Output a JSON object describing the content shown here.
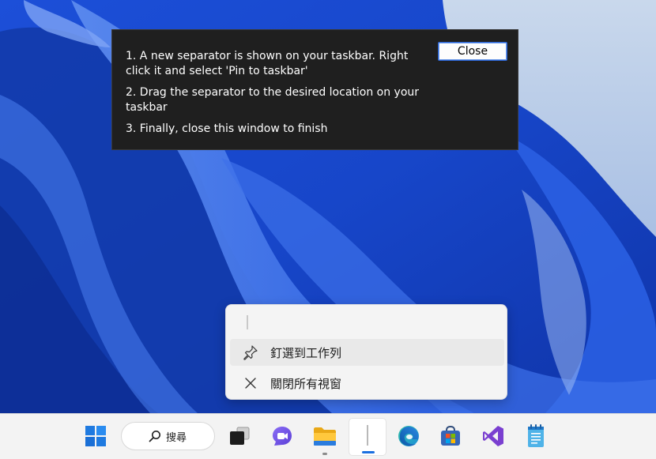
{
  "dialog": {
    "step1": "1. A new separator is shown on your taskbar. Right click it and select 'Pin to taskbar'",
    "step2": "2. Drag the separator to the desired location on your taskbar",
    "step3": "3. Finally, close this window to finish",
    "close_label": "Close"
  },
  "jumplist": {
    "items": [
      {
        "label": "釘選到工作列",
        "icon": "pin-icon"
      },
      {
        "label": "關閉所有視窗",
        "icon": "close-icon"
      }
    ]
  },
  "taskbar": {
    "search_label": "搜尋",
    "icons": [
      "windows-start-icon",
      "search-icon",
      "task-view-icon",
      "chat-icon",
      "file-explorer-icon",
      "separator-icon",
      "edge-icon",
      "store-icon",
      "visual-studio-icon",
      "notepad-icon"
    ]
  },
  "colors": {
    "wallpaper_blue": "#1a4fd6",
    "dialog_bg": "#1f1f1f",
    "taskbar_bg": "#f3f3f3",
    "accent": "#1a6fe0"
  }
}
